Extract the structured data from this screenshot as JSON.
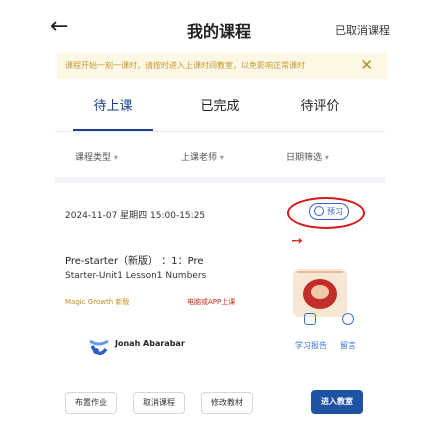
{
  "header": {
    "back_label": "←",
    "title": "我的课程",
    "cancelled_link": "已取消课程"
  },
  "notice": {
    "text": "课程开始一刻一课时，请按时进入上课时间教室，以免影响正常课时",
    "close_label": "✕"
  },
  "tabs": [
    {
      "label": "待上课",
      "active": true
    },
    {
      "label": "已完成",
      "active": false
    },
    {
      "label": "待评价",
      "active": false
    }
  ],
  "filters": [
    {
      "label": "课程类型",
      "caret": "▾"
    },
    {
      "label": "上课老师",
      "caret": "▾"
    },
    {
      "label": "日期筛选",
      "caret": "▾"
    }
  ],
  "lesson": {
    "datetime": "2024-11-07 星期四 15:00-15:25",
    "preview_label": "预习",
    "course_name": "Pre-starter（新版） ：1：Pre",
    "unit_title": "Starter-Unit1 Lesson1 Numbers",
    "tag1": "Magic Growth 新版",
    "tag2": "电脑或APP上课",
    "teacher_name": "Jonah Abarabar",
    "action_labels": [
      "学习报告",
      "留言"
    ],
    "buttons": [
      "布置作业",
      "取消课程",
      "修改教材"
    ],
    "primary_button": "进入教室"
  }
}
